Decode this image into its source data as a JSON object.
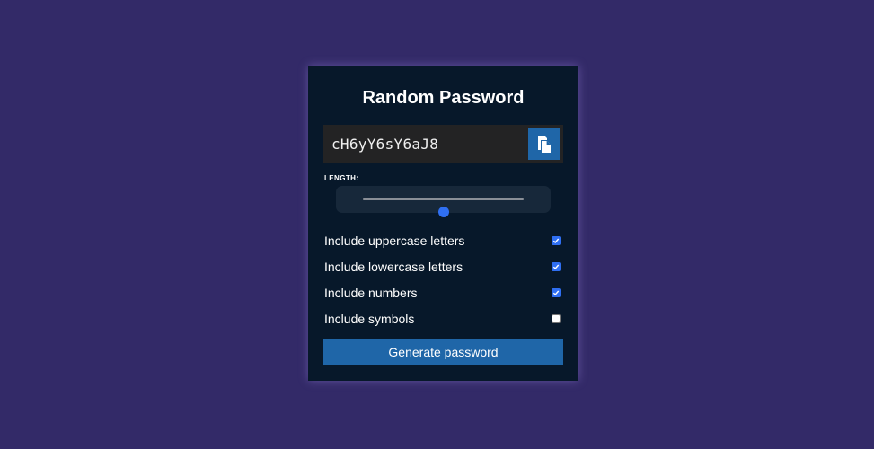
{
  "app": {
    "title": "Random Password"
  },
  "result": {
    "password": "cH6yY6sY6aJ8",
    "copy_icon": "clipboard-copy-icon"
  },
  "length": {
    "label": "LENGTH:",
    "slider_fraction": 0.5
  },
  "options": [
    {
      "label": "Include uppercase letters",
      "checked": true
    },
    {
      "label": "Include lowercase letters",
      "checked": true
    },
    {
      "label": "Include numbers",
      "checked": true
    },
    {
      "label": "Include symbols",
      "checked": false
    }
  ],
  "generate": {
    "label": "Generate password"
  },
  "colors": {
    "background": "#332a68",
    "card": "#07182a",
    "accent": "#1f66a8",
    "checkbox_accent": "#2f6ff2"
  }
}
